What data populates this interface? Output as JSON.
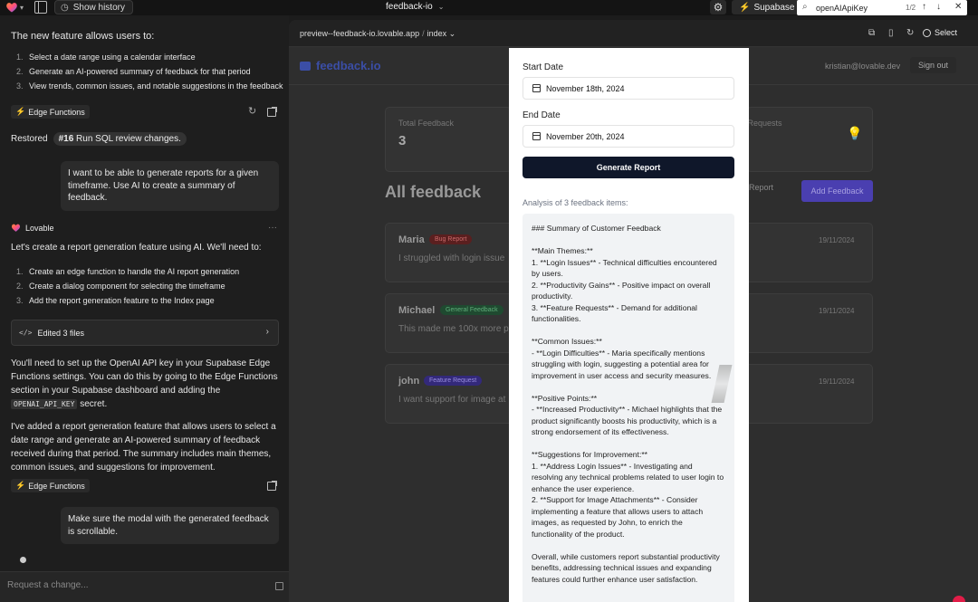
{
  "topbar": {
    "history_label": "Show history",
    "project_name": "feedback-io",
    "supabase_label": "Supabase",
    "find_term": "openAIApiKey",
    "find_count": "1/2"
  },
  "chat": {
    "intro": "The new feature allows users to:",
    "features": [
      {
        "n": "1.",
        "text": "Select a date range using a calendar interface"
      },
      {
        "n": "2.",
        "text": "Generate an AI-powered summary of feedback for that period"
      },
      {
        "n": "3.",
        "text": "View trends, common issues, and notable suggestions in the feedback"
      }
    ],
    "edge_functions_label": "Edge Functions",
    "restored_label": "Restored",
    "restored_pill_num": "#16",
    "restored_pill_text": "Run SQL review changes.",
    "user_msg_1": "I want to be able to generate reports for a given timeframe. Use AI to create a summary of feedback.",
    "assistant_name": "Lovable",
    "more_label": "···",
    "plan_intro": "Let's create a report generation feature using AI. We'll need to:",
    "plan_steps": [
      {
        "n": "1.",
        "text": "Create an edge function to handle the AI report generation"
      },
      {
        "n": "2.",
        "text": "Create a dialog component for selecting the timeframe"
      },
      {
        "n": "3.",
        "text": "Add the report generation feature to the Index page"
      }
    ],
    "edited_label": "Edited 3 files",
    "setup_text_1": "You'll need to set up the OpenAI API key in your Supabase Edge Functions settings. You can do this by going to the Edge Functions section in your Supabase dashboard and adding the",
    "setup_code": "OPENAI_API_KEY",
    "setup_text_2": "secret.",
    "added_text": "I've added a report generation feature that allows users to select a date range and generate an AI-powered summary of feedback received during that period. The summary includes main themes, common issues, and suggestions for improvement.",
    "user_msg_2": "Make sure the modal with the generated feedback is scrollable.",
    "request_placeholder": "Request a change..."
  },
  "preview": {
    "url": "preview--feedback-io.lovable.app",
    "route": "index",
    "select_label": "Select",
    "app": {
      "brand": "feedback.io",
      "email": "kristian@lovable.dev",
      "signout": "Sign out",
      "stats": [
        {
          "label": "Total Feedback",
          "value": "3"
        },
        {
          "label": "re Requests",
          "value": ""
        }
      ],
      "heading": "All feedback",
      "generate_report_bg": "te Report",
      "add_feedback": "Add Feedback",
      "items": [
        {
          "name": "Maria",
          "tag": "Bug Report",
          "text": "I struggled with login issue",
          "date": "19/11/2024"
        },
        {
          "name": "Michael",
          "tag": "General Feedback",
          "text": "This made me 100x more p",
          "date": "19/11/2024"
        },
        {
          "name": "john",
          "tag": "Feature Request",
          "text": "I want support for image at",
          "date": "19/11/2024"
        }
      ]
    },
    "modal": {
      "start_label": "Start Date",
      "start_value": "November 18th, 2024",
      "end_label": "End Date",
      "end_value": "November 20th, 2024",
      "generate_button": "Generate Report",
      "analysis_label": "Analysis of 3 feedback items:",
      "summary_lines": [
        "### Summary of Customer Feedback",
        "",
        "**Main Themes:**",
        "1. **Login Issues** - Technical difficulties encountered by users.",
        "2. **Productivity Gains** - Positive impact on overall productivity.",
        "3. **Feature Requests** - Demand for additional functionalities.",
        "",
        "**Common Issues:**",
        "- **Login Difficulties** - Maria specifically mentions struggling with login, suggesting a potential area for improvement in user access and security measures.",
        "",
        "**Positive Points:**",
        "- **Increased Productivity** - Michael highlights that the product significantly boosts his productivity, which is a strong endorsement of its effectiveness.",
        "",
        "**Suggestions for Improvement:**",
        "1. **Address Login Issues** - Investigating and resolving any technical problems related to user login to enhance the user experience.",
        "2. **Support for Image Attachments** - Consider implementing a feature that allows users to attach images, as requested by John, to enrich the functionality of the product.",
        "",
        "Overall, while customers report substantial productivity benefits, addressing technical issues and expanding features could further enhance user satisfaction."
      ]
    }
  },
  "colors": {
    "accent": "#3ecf8e",
    "brand": "#3b4ea6",
    "button_dark": "#0f172a",
    "tag_bug": "#7a1f1f",
    "tag_general": "#1f5a37",
    "tag_feature": "#3b2c8a"
  }
}
